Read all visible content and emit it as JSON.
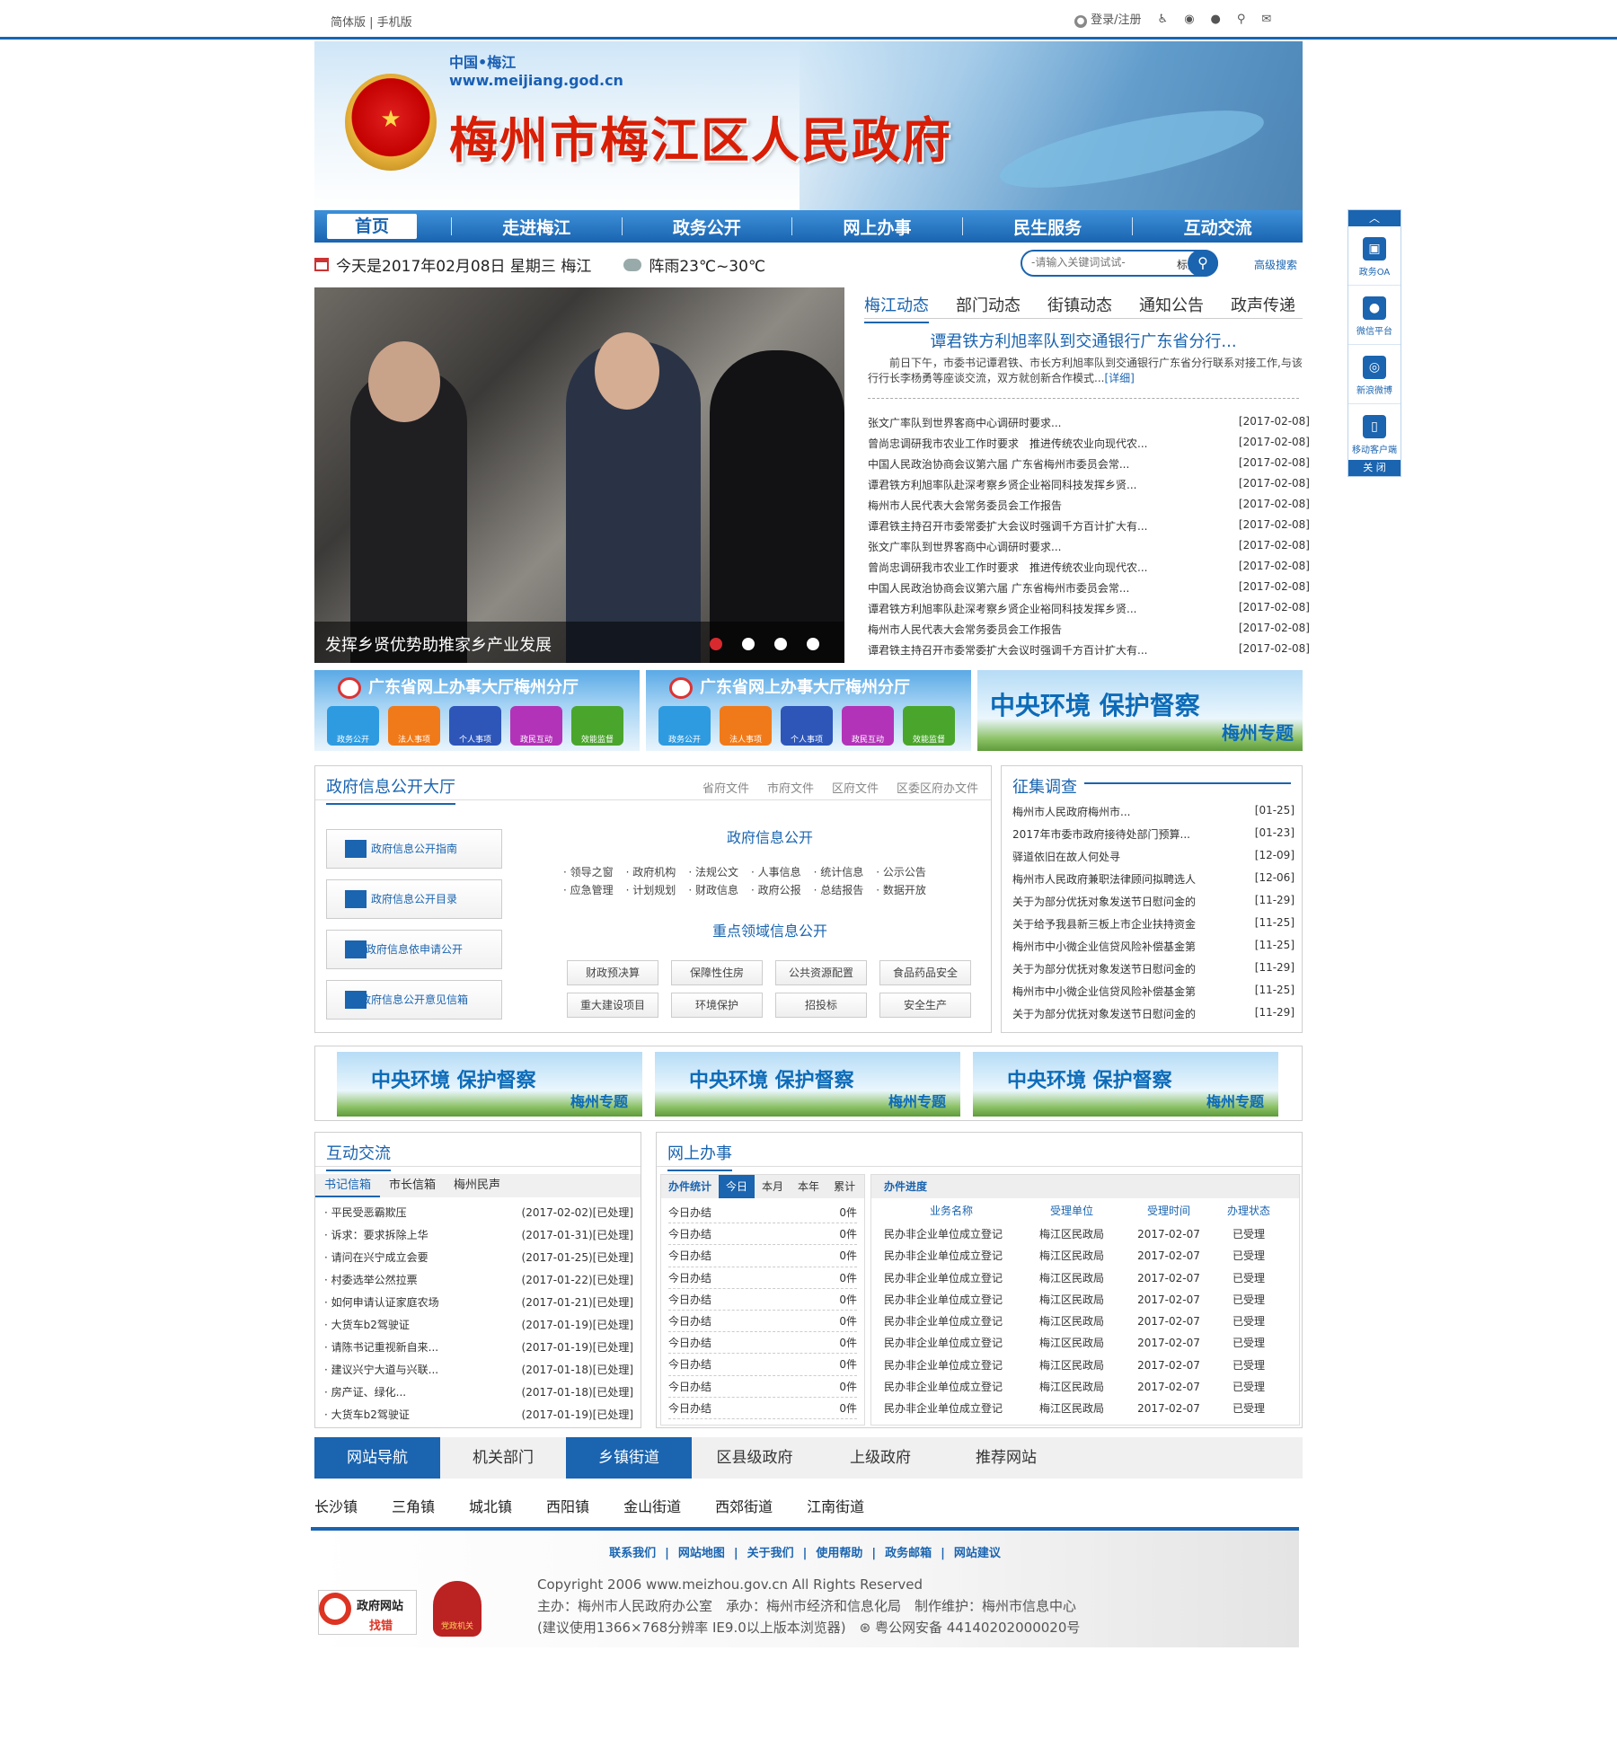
{
  "topbar": {
    "left_links": [
      "简体版",
      "手机版"
    ],
    "login": "登录/注册"
  },
  "banner": {
    "cn": "中国•梅江",
    "url": "www.meijiang.god.cn",
    "title": "梅州市梅江区人民政府"
  },
  "nav": {
    "items": [
      "首页",
      "走进梅江",
      "政务公开",
      "网上办事",
      "民生服务",
      "互动交流"
    ]
  },
  "date": {
    "text": "今天是2017年02月08日 星期三 梅江",
    "weather": "阵雨23℃~30℃"
  },
  "search": {
    "placeholder": "-请输入关键词试试-",
    "category": "标题",
    "advanced": "高级搜索"
  },
  "photo": {
    "caption": "发挥乡贤优势助推家乡产业发展"
  },
  "news": {
    "tabs": [
      "梅江动态",
      "部门动态",
      "街镇动态",
      "通知公告",
      "政声传递"
    ],
    "headline": "谭君铁方利旭率队到交通银行广东省分行...",
    "summary": "前日下午，市委书记谭君铁、市长方利旭率队到交通银行广东省分行联系对接工作,与该行行长李杨勇等座谈交流，双方就创新合作模式...",
    "detail": "[详细]",
    "items": [
      {
        "t": "张文广率队到世界客商中心调研时要求...",
        "d": "[2017-02-08]"
      },
      {
        "t": "曾尚忠调研我市农业工作时要求　推进传统农业向现代农...",
        "d": "[2017-02-08]"
      },
      {
        "t": "中国人民政治协商会议第六届 广东省梅州市委员会常...",
        "d": "[2017-02-08]"
      },
      {
        "t": "谭君铁方利旭率队赴深考察乡贤企业裕同科技发挥乡贤...",
        "d": "[2017-02-08]"
      },
      {
        "t": "梅州市人民代表大会常务委员会工作报告",
        "d": "[2017-02-08]"
      },
      {
        "t": "谭君铁主持召开市委常委扩大会议时强调千方百计扩大有...",
        "d": "[2017-02-08]"
      },
      {
        "t": "张文广率队到世界客商中心调研时要求...",
        "d": "[2017-02-08]"
      },
      {
        "t": "曾尚忠调研我市农业工作时要求　推进传统农业向现代农...",
        "d": "[2017-02-08]"
      },
      {
        "t": "中国人民政治协商会议第六届 广东省梅州市委员会常...",
        "d": "[2017-02-08]"
      },
      {
        "t": "谭君铁方利旭率队赴深考察乡贤企业裕同科技发挥乡贤...",
        "d": "[2017-02-08]"
      },
      {
        "t": "梅州市人民代表大会常务委员会工作报告",
        "d": "[2017-02-08]"
      },
      {
        "t": "谭君铁主持召开市委常委扩大会议时强调千方百计扩大有...",
        "d": "[2017-02-08]"
      }
    ]
  },
  "float": {
    "items": [
      "政务OA",
      "微信平台",
      "新浪微博",
      "移动客户端"
    ],
    "close": "关 闭"
  },
  "service": {
    "title": "广东省网上办事大厅梅州分厅",
    "icons": [
      "政务公开",
      "法人事项",
      "个人事项",
      "政民互动",
      "效能监督"
    ]
  },
  "env": {
    "t1": "中央环境 保护督察",
    "t2": "梅州专题"
  },
  "govinfo": {
    "title": "政府信息公开大厅",
    "links": [
      "省府文件",
      "市府文件",
      "区府文件",
      "区委区府办文件"
    ],
    "buttons": [
      "政府信息公开指南",
      "政府信息公开目录",
      "政府信息依申请公开",
      "政府信息公开意见信箱"
    ],
    "h1": "政府信息公开",
    "cats": [
      "领导之窗",
      "政府机构",
      "法规公文",
      "人事信息",
      "统计信息",
      "公示公告",
      "应急管理",
      "计划规划",
      "财政信息",
      "政府公报",
      "总结报告",
      "数据开放"
    ],
    "h2": "重点领域信息公开",
    "tags": [
      "财政预决算",
      "保障性住房",
      "公共资源配置",
      "食品药品安全",
      "重大建设项目",
      "环境保护",
      "招投标",
      "安全生产"
    ]
  },
  "survey": {
    "title": "征集调查",
    "items": [
      {
        "t": "梅州市人民政府梅州市...",
        "d": "[01-25]"
      },
      {
        "t": "2017年市委市政府接待处部门预算...",
        "d": "[01-23]"
      },
      {
        "t": "驿道依旧在故人何处寻",
        "d": "[12-09]"
      },
      {
        "t": "梅州市人民政府兼职法律顾问拟聘选人",
        "d": "[12-06]"
      },
      {
        "t": "关于为部分优抚对象发送节日慰问金的",
        "d": "[11-29]"
      },
      {
        "t": "关于给予我县新三板上市企业扶持资金",
        "d": "[11-25]"
      },
      {
        "t": "梅州市中小微企业信贷风险补偿基金第",
        "d": "[11-25]"
      },
      {
        "t": "关于为部分优抚对象发送节日慰问金的",
        "d": "[11-29]"
      },
      {
        "t": "梅州市中小微企业信贷风险补偿基金第",
        "d": "[11-25]"
      },
      {
        "t": "关于为部分优抚对象发送节日慰问金的",
        "d": "[11-29]"
      }
    ]
  },
  "interact": {
    "title": "互动交流",
    "tabs": [
      "书记信箱",
      "市长信箱",
      "梅州民声"
    ],
    "items": [
      {
        "t": "· 平民受恶霸欺压",
        "d": "(2017-02-02)[已处理]"
      },
      {
        "t": "· 诉求：要求拆除上华",
        "d": "(2017-01-31)[已处理]"
      },
      {
        "t": "· 请问在兴宁成立会要",
        "d": "(2017-01-25)[已处理]"
      },
      {
        "t": "· 村委选举公然拉票",
        "d": "(2017-01-22)[已处理]"
      },
      {
        "t": "· 如何申请认证家庭农场",
        "d": "(2017-01-21)[已处理]"
      },
      {
        "t": "· 大货车b2驾驶证",
        "d": "(2017-01-19)[已处理]"
      },
      {
        "t": "· 请陈书记重视新自来...",
        "d": "(2017-01-19)[已处理]"
      },
      {
        "t": "· 建议兴宁大道与兴联...",
        "d": "(2017-01-18)[已处理]"
      },
      {
        "t": "· 房产证、绿化...",
        "d": "(2017-01-18)[已处理]"
      },
      {
        "t": "· 大货车b2驾驶证",
        "d": "(2017-01-19)[已处理]"
      }
    ]
  },
  "online": {
    "title": "网上办事",
    "stat_label": "办件统计",
    "stat_tabs": [
      "今日",
      "本月",
      "本年",
      "累计"
    ],
    "stat_rows": [
      {
        "k": "今日办结",
        "v": "0件"
      },
      {
        "k": "今日办结",
        "v": "0件"
      },
      {
        "k": "今日办结",
        "v": "0件"
      },
      {
        "k": "今日办结",
        "v": "0件"
      },
      {
        "k": "今日办结",
        "v": "0件"
      },
      {
        "k": "今日办结",
        "v": "0件"
      },
      {
        "k": "今日办结",
        "v": "0件"
      },
      {
        "k": "今日办结",
        "v": "0件"
      },
      {
        "k": "今日办结",
        "v": "0件"
      },
      {
        "k": "今日办结",
        "v": "0件"
      }
    ],
    "progress_title": "办件进度",
    "cols": [
      "业务名称",
      "受理单位",
      "受理时间",
      "办理状态"
    ],
    "rows": [
      [
        "民办非企业单位成立登记",
        "梅江区民政局",
        "2017-02-07",
        "已受理"
      ],
      [
        "民办非企业单位成立登记",
        "梅江区民政局",
        "2017-02-07",
        "已受理"
      ],
      [
        "民办非企业单位成立登记",
        "梅江区民政局",
        "2017-02-07",
        "已受理"
      ],
      [
        "民办非企业单位成立登记",
        "梅江区民政局",
        "2017-02-07",
        "已受理"
      ],
      [
        "民办非企业单位成立登记",
        "梅江区民政局",
        "2017-02-07",
        "已受理"
      ],
      [
        "民办非企业单位成立登记",
        "梅江区民政局",
        "2017-02-07",
        "已受理"
      ],
      [
        "民办非企业单位成立登记",
        "梅江区民政局",
        "2017-02-07",
        "已受理"
      ],
      [
        "民办非企业单位成立登记",
        "梅江区民政局",
        "2017-02-07",
        "已受理"
      ],
      [
        "民办非企业单位成立登记",
        "梅江区民政局",
        "2017-02-07",
        "已受理"
      ]
    ]
  },
  "sitenav": {
    "tabs": [
      "网站导航",
      "机关部门",
      "乡镇街道",
      "区县级政府",
      "上级政府",
      "推荐网站"
    ],
    "towns": [
      "长沙镇",
      "三角镇",
      "城北镇",
      "西阳镇",
      "金山街道",
      "西郊街道",
      "江南街道"
    ]
  },
  "footer": {
    "links": [
      "联系我们",
      "网站地图",
      "关于我们",
      "使用帮助",
      "政务邮箱",
      "网站建议"
    ],
    "copyright": "Copyright 2006 www.meizhou.gov.cn All Rights Reserved",
    "host": "主办：梅州市人民政府办公室　承办：梅州市经济和信息化局　制作维护：梅州市信息中心",
    "browser": "(建议使用1366×768分辨率 IE9.0以上版本浏览器)",
    "icp": "粤公网安备 44140202000020号",
    "badge1a": "政府网站",
    "badge1b": "找错",
    "badge2": "党政机关"
  }
}
